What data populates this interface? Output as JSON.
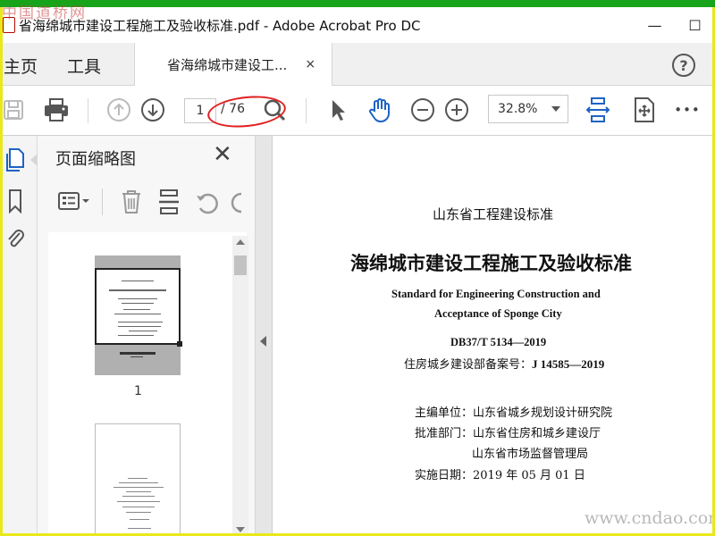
{
  "watermark_top": "中国道桥网",
  "watermark_bottom": "www.cndao.com",
  "window": {
    "title": "省海绵城市建设工程施工及验收标准.pdf - Adobe Acrobat Pro DC",
    "minimize": "—",
    "maximize": "☐"
  },
  "tabs": {
    "home": "主页",
    "tools": "工具",
    "doc": "省海绵城市建设工...",
    "doc_close": "×",
    "help": "?"
  },
  "toolbar": {
    "page_current": "1",
    "page_total": "/ 76",
    "zoom": "32.8%",
    "more": "•••"
  },
  "thumbnail_panel": {
    "title": "页面缩略图",
    "close": "✕",
    "page1_number": "1"
  },
  "document": {
    "standard_type": "山东省工程建设标准",
    "title_cn": "海绵城市建设工程施工及验收标准",
    "title_en_line1": "Standard for Engineering Construction and",
    "title_en_line2": "Acceptance of Sponge City",
    "code": "DB37/T 5134—2019",
    "record_label": "住房城乡建设部备案号：",
    "record_number": "J 14585—2019",
    "editor": "主编单位：山东省城乡规划设计研究院",
    "approver_1": "批准部门：山东省住房和城乡建设厅",
    "approver_2": "山东省市场监督管理局",
    "effective_date": "实施日期：2019 年 05 月 01 日"
  },
  "colors": {
    "accent_blue": "#1e63c6",
    "annotation_red": "#e02020",
    "window_green": "#17a41a",
    "frame_yellow": "#e8e81a"
  }
}
